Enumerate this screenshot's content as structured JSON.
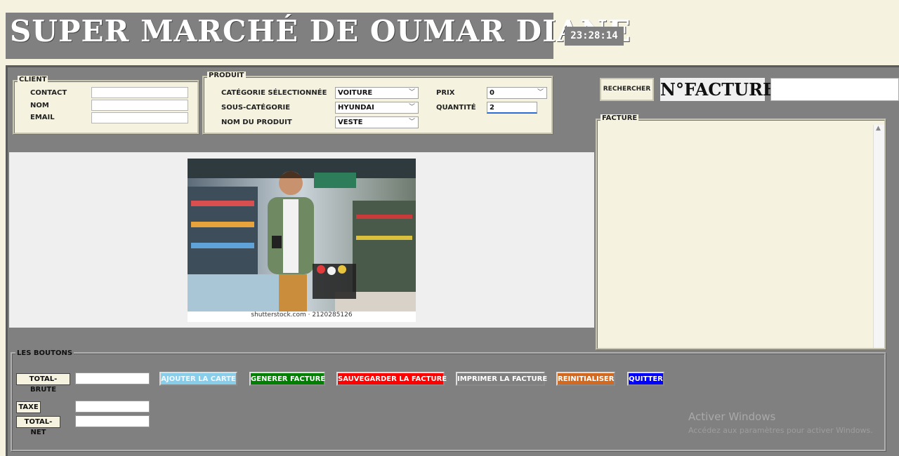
{
  "header": {
    "title": "SUPER MARCHÉ DE OUMAR DIANE",
    "clock": "23:28:14"
  },
  "client": {
    "legend": "CLIENT",
    "contact_label": "CONTACT",
    "contact_value": "",
    "nom_label": "NOM",
    "nom_value": "",
    "email_label": "EMAIL",
    "email_value": ""
  },
  "produit": {
    "legend": "PRODUIT",
    "categorie_label": "CATÉGORIE SÉLECTIONNÉE",
    "categorie_value": "VOITURE",
    "sous_categorie_label": "SOUS-CATÉGORIE",
    "sous_categorie_value": "HYUNDAI",
    "nom_produit_label": "NOM DU PRODUIT",
    "nom_produit_value": "VESTE",
    "prix_label": "PRIX",
    "prix_value": "0",
    "quantite_label": "QUANTITÉ",
    "quantite_value": "2"
  },
  "image": {
    "caption": "shutterstock.com · 2120285126"
  },
  "search": {
    "button_label": "RECHERCHER",
    "facture_label": "N°FACTURE",
    "facture_value": ""
  },
  "facture": {
    "legend": "FACTURE",
    "content": ""
  },
  "boutons": {
    "legend": "LES BOUTONS",
    "total_brute_label": "TOTAL-BRUTE",
    "taxe_label": "TAXE",
    "total_net_label": "TOTAL-NET",
    "ajouter_label": "AJOUTER LA CARTE",
    "generer_label": "GENERER FACTURE",
    "sauvegarder_label": "SAUVEGARDER LA FACTURE",
    "imprimer_label": "IMPRIMER LA FACTURE",
    "reinitialiser_label": "REINITIALISER",
    "quitter_label": "QUITTER",
    "colors": {
      "ajouter": "#87ceeb",
      "generer": "#008000",
      "sauvegarder": "#ff0000",
      "imprimer": "#808080",
      "reinitialiser": "#d2691e",
      "quitter": "#0000ff"
    }
  },
  "watermark": {
    "line1": "Activer Windows",
    "line2": "Accédez aux paramètres pour activer Windows."
  }
}
